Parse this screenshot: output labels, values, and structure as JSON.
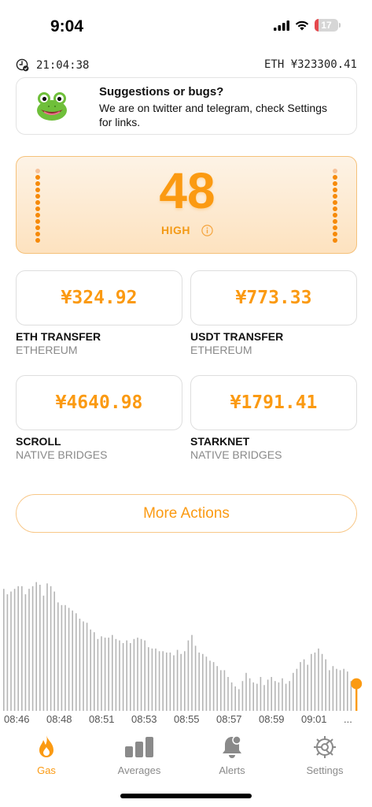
{
  "status_bar": {
    "time": "9:04",
    "battery_level": "17",
    "battery_fraction": 0.17,
    "icons": [
      "cellular-signal-icon",
      "wifi-icon",
      "battery-icon"
    ]
  },
  "info": {
    "clock_icon": "clock-icon",
    "time": "21:04:38",
    "eth_price": "ETH ¥323300.41"
  },
  "suggestion": {
    "icon": "frog-icon",
    "title": "Suggestions or bugs?",
    "body": "We are on twitter and telegram, check Settings for links."
  },
  "gas": {
    "value": "48",
    "level": "HIGH",
    "info_icon": "info-icon",
    "accent_color": "#fb9a12"
  },
  "tiles": [
    {
      "price": "¥324.92",
      "name": "ETH TRANSFER",
      "network": "ETHEREUM"
    },
    {
      "price": "¥773.33",
      "name": "USDT TRANSFER",
      "network": "ETHEREUM"
    },
    {
      "price": "¥4640.98",
      "name": "SCROLL",
      "network": "NATIVE BRIDGES"
    },
    {
      "price": "¥1791.41",
      "name": "STARKNET",
      "network": "NATIVE BRIDGES"
    }
  ],
  "more_actions": "More Actions",
  "chart": {
    "x_ticks": [
      "08:46",
      "08:48",
      "08:51",
      "08:53",
      "08:55",
      "08:57",
      "08:59",
      "09:01",
      "..."
    ],
    "bars": [
      0.9,
      0.86,
      0.88,
      0.9,
      0.92,
      0.92,
      0.86,
      0.9,
      0.92,
      0.95,
      0.93,
      0.85,
      0.94,
      0.92,
      0.88,
      0.8,
      0.78,
      0.78,
      0.76,
      0.74,
      0.72,
      0.68,
      0.66,
      0.65,
      0.6,
      0.58,
      0.53,
      0.55,
      0.54,
      0.54,
      0.56,
      0.53,
      0.52,
      0.5,
      0.52,
      0.5,
      0.53,
      0.54,
      0.53,
      0.52,
      0.47,
      0.46,
      0.46,
      0.44,
      0.44,
      0.43,
      0.43,
      0.41,
      0.45,
      0.42,
      0.44,
      0.52,
      0.56,
      0.48,
      0.43,
      0.42,
      0.4,
      0.37,
      0.36,
      0.33,
      0.3,
      0.3,
      0.25,
      0.21,
      0.18,
      0.16,
      0.22,
      0.28,
      0.24,
      0.21,
      0.2,
      0.25,
      0.19,
      0.23,
      0.25,
      0.22,
      0.21,
      0.24,
      0.2,
      0.22,
      0.28,
      0.31,
      0.36,
      0.38,
      0.34,
      0.42,
      0.43,
      0.46,
      0.42,
      0.38,
      0.3,
      0.33,
      0.31,
      0.3,
      0.31,
      0.29,
      0.22
    ],
    "bar_color": "#b5b5b5",
    "current_value_fraction": 0.2
  },
  "tabs": [
    {
      "label": "Gas",
      "icon": "flame-icon",
      "active": true
    },
    {
      "label": "Averages",
      "icon": "bar-chart-icon",
      "active": false
    },
    {
      "label": "Alerts",
      "icon": "bell-icon",
      "active": false
    },
    {
      "label": "Settings",
      "icon": "gear-icon",
      "active": false
    }
  ]
}
